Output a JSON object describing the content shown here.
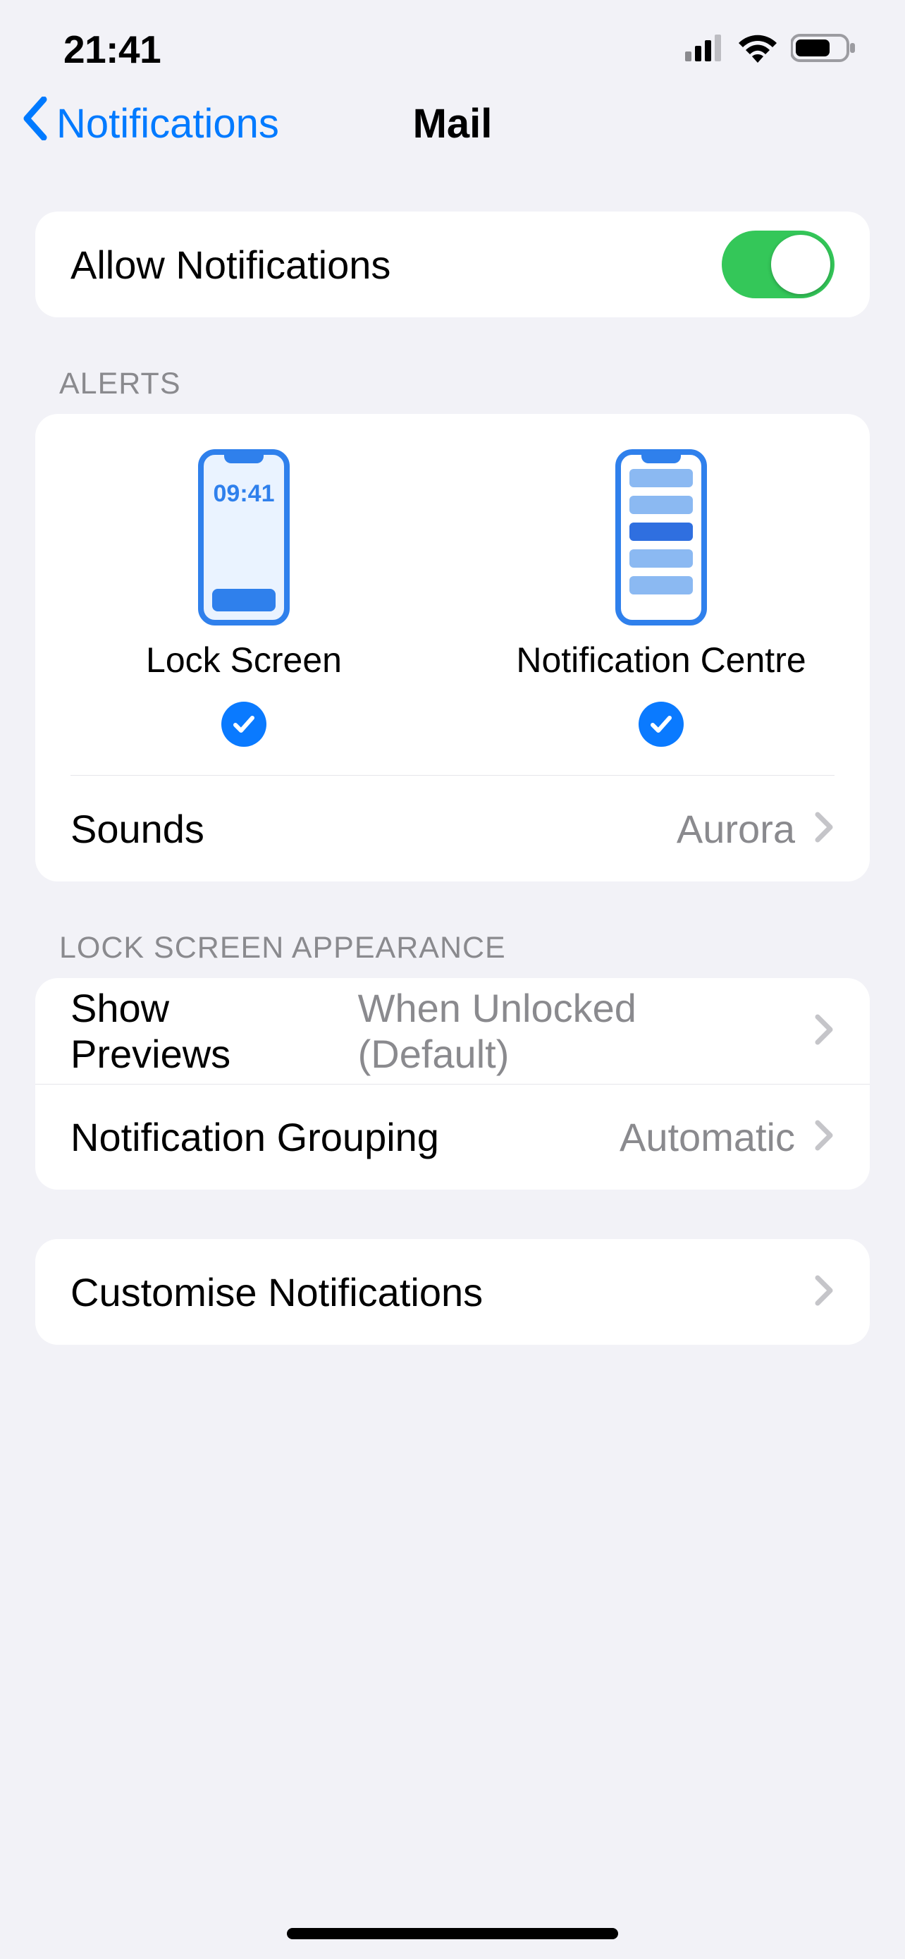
{
  "status": {
    "time": "21:41"
  },
  "nav": {
    "back_label": "Notifications",
    "title": "Mail"
  },
  "allow": {
    "label": "Allow Notifications",
    "on": true
  },
  "alerts": {
    "header": "ALERTS",
    "phone_time": "09:41",
    "options": [
      {
        "label": "Lock Screen",
        "checked": true
      },
      {
        "label": "Notification Centre",
        "checked": true
      }
    ],
    "sounds_label": "Sounds",
    "sounds_value": "Aurora"
  },
  "lockscreen": {
    "header": "LOCK SCREEN APPEARANCE",
    "previews_label": "Show Previews",
    "previews_value": "When Unlocked (Default)",
    "grouping_label": "Notification Grouping",
    "grouping_value": "Automatic"
  },
  "customise": {
    "label": "Customise Notifications"
  }
}
